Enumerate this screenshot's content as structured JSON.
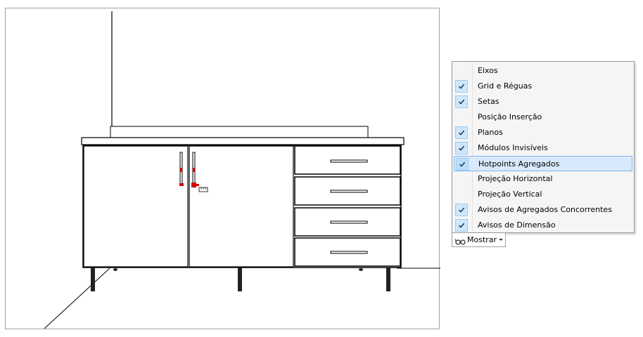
{
  "menu": {
    "items": [
      {
        "label": "Eixos",
        "checked": false
      },
      {
        "label": "Grid e Réguas",
        "checked": true
      },
      {
        "label": "Setas",
        "checked": true
      },
      {
        "label": "Posição Inserção",
        "checked": false
      },
      {
        "label": "Planos",
        "checked": true
      },
      {
        "label": "Módulos Invisíveis",
        "checked": true
      },
      {
        "label": "Hotpoints Agregados",
        "checked": true,
        "highlighted": true
      },
      {
        "label": "Projeção Horizontal",
        "checked": false
      },
      {
        "label": "Projeção Vertical",
        "checked": false
      },
      {
        "label": "Avisos de Agregados Concorrentes",
        "checked": true
      },
      {
        "label": "Avisos de Dimensão",
        "checked": true
      }
    ]
  },
  "toolbar": {
    "mostrar_label": "Mostrar",
    "mostrar_icon": "glasses-icon"
  },
  "colors": {
    "check_bg": "#cfe7fb",
    "highlight_bg": "#d7e9fb",
    "hotpoint": "#d40000"
  }
}
